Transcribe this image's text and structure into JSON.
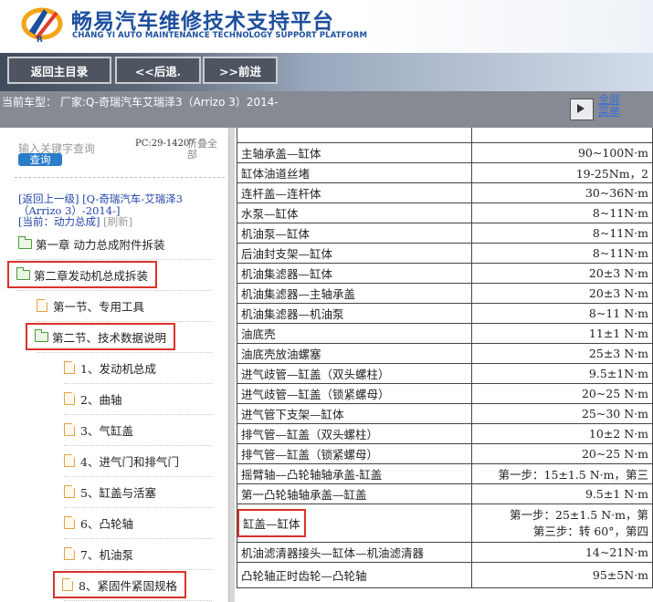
{
  "header": {
    "title": "畅易汽车维修技术支持平台",
    "subtitle": "CHANG YI AUTO MAINTENANCE TECHNOLOGY SUPPORT PLATFORM"
  },
  "toolbar": {
    "home_label": "返回主目录",
    "back_label": "<<后退.",
    "forward_label": ">>前进"
  },
  "vehicle_bar": {
    "text": "当前车型： 厂家:Q-奇瑞汽车艾瑞泽3（Arrizo 3）2014-",
    "fullscreen_label": "全屏菜单"
  },
  "sidebar": {
    "search_placeholder": "输入关键字查询",
    "search_button": "查询",
    "pc_code": "PC:29-14207",
    "collapse_label": "折叠全部",
    "breadcrumb_up": "[返回上一级]",
    "breadcrumb_model": "[Q-奇瑞汽车-艾瑞泽3（Arrizo 3）-2014-]",
    "breadcrumb_current": "[当前：动力总成]",
    "refresh": "[刷新]",
    "items": [
      {
        "label": "第一章 动力总成附件拆装",
        "icon": "folder-icon",
        "level": 0,
        "highlighted": false
      },
      {
        "label": "第二章发动机总成拆装",
        "icon": "folder-icon",
        "level": 0,
        "highlighted": true
      },
      {
        "label": "第一节、专用工具",
        "icon": "document-icon",
        "level": 1,
        "highlighted": false
      },
      {
        "label": "第二节、技术数据说明",
        "icon": "folder-icon",
        "level": 1,
        "highlighted": true
      },
      {
        "label": "1、发动机总成",
        "icon": "document-icon",
        "level": 2,
        "highlighted": false
      },
      {
        "label": "2、曲轴",
        "icon": "document-icon",
        "level": 2,
        "highlighted": false
      },
      {
        "label": "3、气缸盖",
        "icon": "document-icon",
        "level": 2,
        "highlighted": false
      },
      {
        "label": "4、进气门和排气门",
        "icon": "document-icon",
        "level": 2,
        "highlighted": false
      },
      {
        "label": "5、缸盖与活塞",
        "icon": "document-icon",
        "level": 2,
        "highlighted": false
      },
      {
        "label": "6、凸轮轴",
        "icon": "document-icon",
        "level": 2,
        "highlighted": false
      },
      {
        "label": "7、机油泵",
        "icon": "document-icon",
        "level": 2,
        "highlighted": false
      },
      {
        "label": "8、紧固件紧固规格",
        "icon": "document-icon",
        "level": 2,
        "highlighted": true
      }
    ]
  },
  "torque_table": {
    "rows": [
      {
        "part": "主轴承盖—缸体",
        "value": "90~100N·m"
      },
      {
        "part": "缸体油道丝堵",
        "value": "19-25Nm，2"
      },
      {
        "part": "连杆盖—连杆体",
        "value": "30~36N·m"
      },
      {
        "part": "水泵—缸体",
        "value": "8~11N·m"
      },
      {
        "part": "机油泵—缸体",
        "value": "8~11N·m"
      },
      {
        "part": "后油封支架—缸体",
        "value": "8~11N·m"
      },
      {
        "part": "机油集滤器—缸体",
        "value": "20±3 N·m"
      },
      {
        "part": "机油集滤器—主轴承盖",
        "value": "20±3 N·m"
      },
      {
        "part": "机油集滤器—机油泵",
        "value": "8~11 N·m"
      },
      {
        "part": "油底壳",
        "value": "11±1 N·m"
      },
      {
        "part": "油底壳放油螺塞",
        "value": "25±3 N·m"
      },
      {
        "part": "进气歧管—缸盖（双头螺柱）",
        "value": "9.5±1N·m"
      },
      {
        "part": "进气歧管—缸盖（锁紧螺母）",
        "value": "20~25 N·m"
      },
      {
        "part": "进气管下支架—缸体",
        "value": "25~30 N·m"
      },
      {
        "part": "排气管—缸盖（双头螺柱）",
        "value": "10±2 N·m"
      },
      {
        "part": "排气管—缸盖（锁紧螺母）",
        "value": "20~25 N·m"
      },
      {
        "part": "摇臂轴—凸轮轴轴承盖-缸盖",
        "value": "第一步：15±1.5 N·m，第三"
      },
      {
        "part": "第一凸轮轴轴承盖—缸盖",
        "value": "9.5±1 N·m"
      },
      {
        "part": "缸盖—缸体",
        "value": "第一步：25±1.5 N·m，第",
        "value2": "第三步：转 60°，第四",
        "highlighted": true
      },
      {
        "part": "机油滤清器接头—缸体—机油滤清器",
        "value": "14~21N·m"
      },
      {
        "part": "凸轮轴正时齿轮—凸轮轴",
        "value": "95±5N·m"
      }
    ]
  }
}
